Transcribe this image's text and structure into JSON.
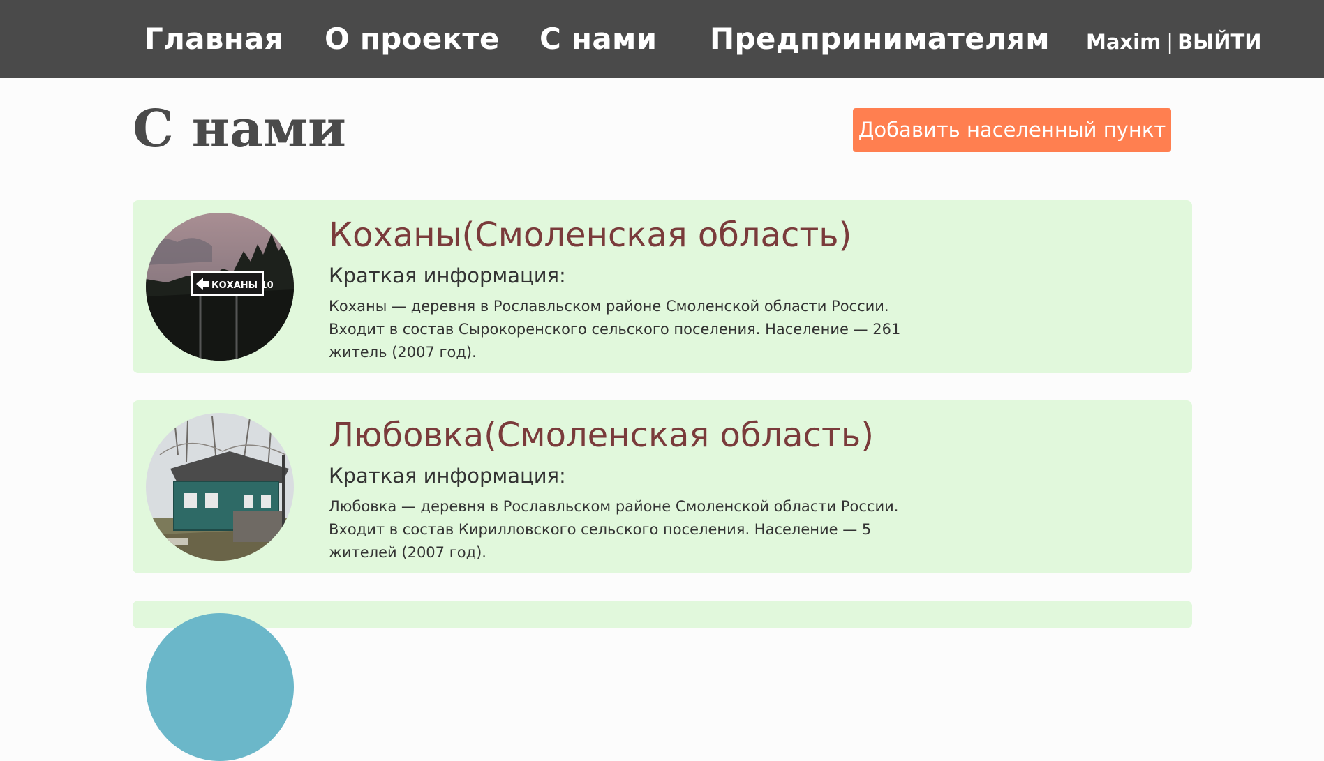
{
  "nav": {
    "items": [
      {
        "label": "Главная"
      },
      {
        "label": "О проекте"
      },
      {
        "label": "С нами"
      },
      {
        "label": "Предпринимателям"
      }
    ],
    "user": "Maxim",
    "separator": "|",
    "logout_label": "ВЫЙТИ"
  },
  "page": {
    "title": "С нами",
    "add_button_label": "Добавить населенный пункт"
  },
  "cards": [
    {
      "title": "Коханы(Смоленская область)",
      "subtitle": "Краткая информация:",
      "text": "Коханы — деревня в Рославльском районе Смоленской области России. Входит в состав Сырокоренского сельского поселения. Население — 261 житель (2007 год).",
      "photo_sign_text": "КОХАНЫ 10"
    },
    {
      "title": "Любовка(Смоленская область)",
      "subtitle": "Краткая информация:",
      "text": "Любовка — деревня в Рославльском районе Смоленской области России. Входит в состав Кирилловского сельского поселения. Население — 5 жителей (2007 год)."
    }
  ],
  "colors": {
    "header_bg": "#4a4a4a",
    "accent": "#ff7f50",
    "card_bg": "#e1f8dc",
    "card_title": "#7a3b3b"
  }
}
